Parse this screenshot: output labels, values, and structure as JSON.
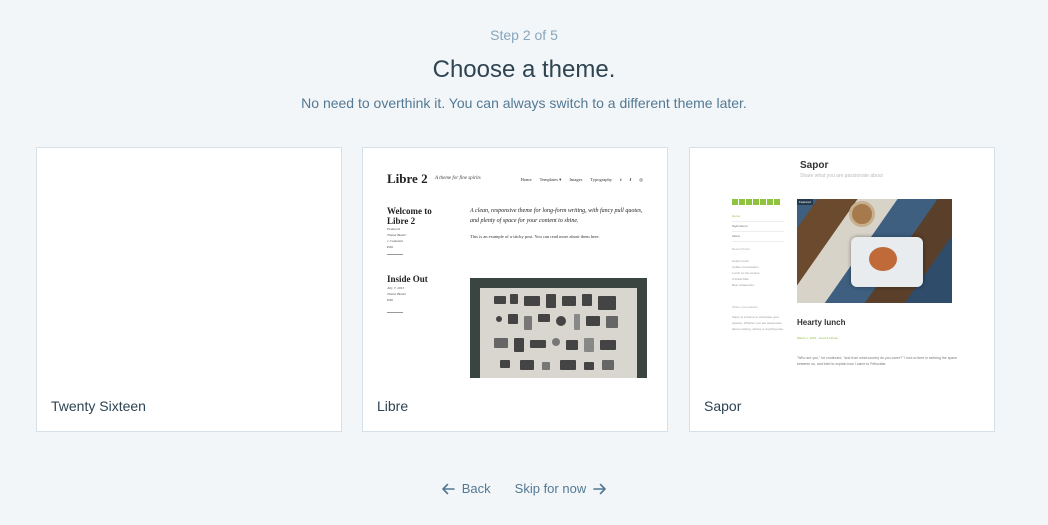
{
  "header": {
    "step": "Step 2 of 5",
    "title": "Choose a theme.",
    "subtitle": "No need to overthink it. You can always switch to a different theme later."
  },
  "themes": [
    {
      "name": "Twenty Sixteen"
    },
    {
      "name": "Libre",
      "preview": {
        "logo": "Libre 2",
        "tagline": "A theme for fine spirits",
        "nav": [
          "Home",
          "Templates ▾",
          "Images",
          "Typography"
        ],
        "posts": [
          {
            "title": "Welcome to Libre 2",
            "meta": [
              "Featured",
              "Theme Buster",
              "1 Comment",
              "Edit"
            ]
          },
          {
            "title": "Inside Out",
            "meta": [
              "July 7, 2015",
              "Theme Buster",
              "Edit"
            ]
          }
        ],
        "quote": "A clean, responsive theme for long-form writing, with fancy pull quotes, and plenty of space for your content to shine.",
        "body": "This is an example of a sticky post. You can read more about them here."
      }
    },
    {
      "name": "Sapor",
      "preview": {
        "site_title": "Sapor",
        "tagline": "Share what you are passionate about",
        "menu": [
          "Home",
          "Style Demo",
          "About"
        ],
        "recent_heading": "Recent Posts",
        "recent_posts": [
          "Hearty lunch",
          "Coffee conversation",
          "Lunch on the terrace",
          "A Rural Ride",
          "Best restaurants"
        ],
        "share_heading": "Share your passion",
        "share_text": "Sapor is a theme to showcase your passion. Whether you are passionate about cooking, writing or anything else.",
        "featured_label": "Featured",
        "post_title": "Hearty lunch",
        "post_meta": "March 1, 2016 · Food & Drinks",
        "post_body": "\"Who are you,\" he continued, \"and from what country do you come?\" I lost no time in seeking the space between us, and tried to explain how I came to Pellucidar."
      }
    }
  ],
  "footer": {
    "back_label": "Back",
    "skip_label": "Skip for now"
  },
  "colors": {
    "background": "#f3f6f8",
    "text_dark": "#2e4453",
    "text_muted": "#87a6bc",
    "link": "#537994",
    "sapor_accent": "#8fc33f"
  }
}
